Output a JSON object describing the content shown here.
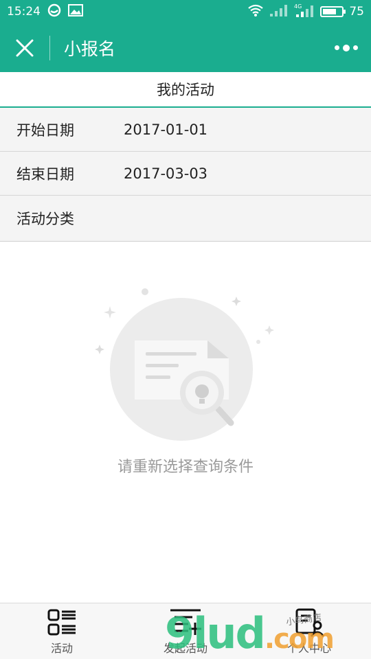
{
  "status_bar": {
    "time": "15:24",
    "battery": "75",
    "battery_level": 0.75,
    "network": "4G"
  },
  "nav": {
    "title": "小报名"
  },
  "page": {
    "title": "我的活动"
  },
  "filters": [
    {
      "label": "开始日期",
      "value": "2017-01-01"
    },
    {
      "label": "结束日期",
      "value": "2017-03-03"
    },
    {
      "label": "活动分类",
      "value": ""
    }
  ],
  "empty_state": {
    "message": "请重新选择查询条件"
  },
  "tabs": [
    {
      "label": "活动",
      "icon": "activity-list-icon"
    },
    {
      "label": "发起活动",
      "icon": "create-activity-icon"
    },
    {
      "label": "个人中心",
      "icon": "profile-icon"
    }
  ],
  "watermark": {
    "brand": "9lud",
    "domain": ".com",
    "tagline": "小鸟商店"
  },
  "colors": {
    "primary": "#1aad8f",
    "watermark_green": "#2bbf7e",
    "watermark_orange": "#f0a030"
  }
}
